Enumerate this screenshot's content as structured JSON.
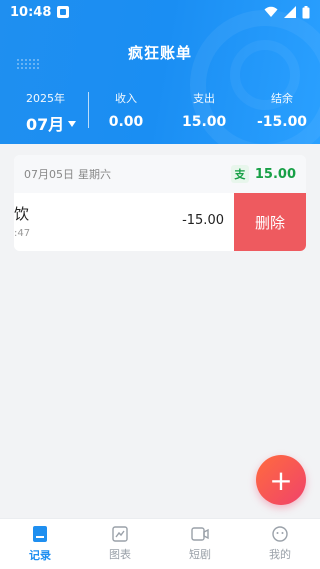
{
  "status_bar": {
    "time": "10:48"
  },
  "header": {
    "title": "疯狂账单",
    "year_label": "2025年",
    "month_label": "07月",
    "summary": {
      "income_label": "收入",
      "income_value": "0.00",
      "expense_label": "支出",
      "expense_value": "15.00",
      "balance_label": "结余",
      "balance_value": "-15.00"
    }
  },
  "records": [
    {
      "date": "07月05日",
      "weekday": "星期六",
      "badge": "支",
      "total": "15.00",
      "items": [
        {
          "category": "饮",
          "time": ":47",
          "amount": "-15.00",
          "delete_label": "删除"
        }
      ]
    }
  ],
  "fab": {
    "icon": "plus-icon",
    "label": "+"
  },
  "bottom_nav": [
    {
      "label": "记录",
      "icon": "record-icon",
      "active": true
    },
    {
      "label": "图表",
      "icon": "chart-icon",
      "active": false
    },
    {
      "label": "短剧",
      "icon": "video-icon",
      "active": false
    },
    {
      "label": "我的",
      "icon": "profile-icon",
      "active": false
    }
  ],
  "colors": {
    "primary": "#1f8ff0",
    "income_green": "#17a046",
    "delete_red": "#ee5a5f",
    "fab_gradient_start": "#ff6b3e",
    "fab_gradient_end": "#f0436b"
  }
}
